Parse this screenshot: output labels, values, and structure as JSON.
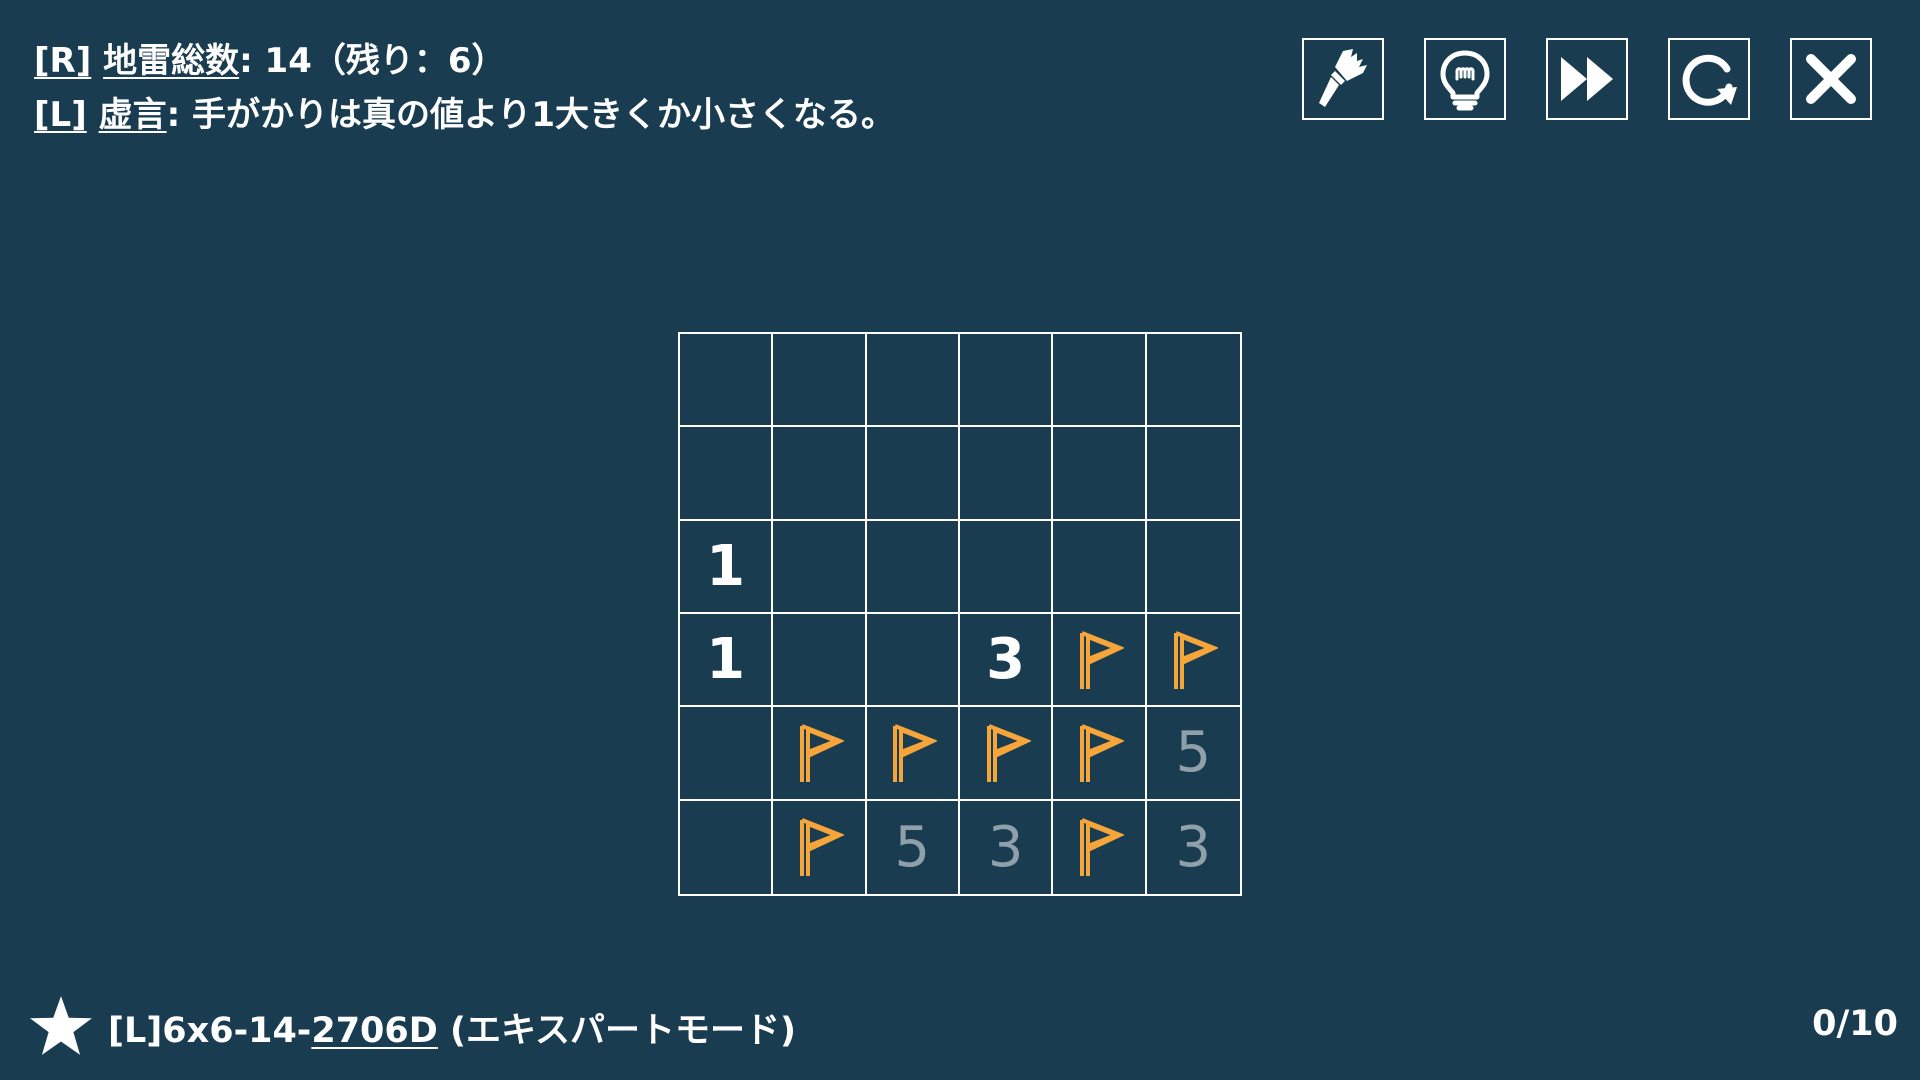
{
  "rules": {
    "line1": {
      "tag": "[R]",
      "name": "地雷総数",
      "text": ":  14（残り：6）"
    },
    "line2": {
      "tag": "[L]",
      "name": "虚言",
      "text": ": 手がかりは真の値より1大きくか小さくなる。"
    }
  },
  "toolbar": {
    "buttons": [
      {
        "name": "brush",
        "icon": "brush-icon"
      },
      {
        "name": "hint",
        "icon": "lightbulb-icon"
      },
      {
        "name": "skip",
        "icon": "fast-forward-icon"
      },
      {
        "name": "restart",
        "icon": "restart-icon"
      },
      {
        "name": "close",
        "icon": "close-icon"
      }
    ]
  },
  "board": {
    "rows": 6,
    "cols": 6,
    "cells": [
      [
        "",
        "",
        "",
        "",
        "",
        ""
      ],
      [
        "",
        "",
        "",
        "",
        "",
        ""
      ],
      [
        "1",
        "",
        "",
        "",
        "",
        ""
      ],
      [
        "1",
        "",
        "",
        "3",
        "F",
        "F"
      ],
      [
        "",
        "F",
        "F",
        "F",
        "F",
        "5r"
      ],
      [
        "",
        "F",
        "5r",
        "3r",
        "F",
        "3r"
      ]
    ],
    "colors": {
      "flag": "#f5a53a",
      "given_number": "#ffffff",
      "revealed_number": "#8fa0ab",
      "grid_line": "#ffffff"
    }
  },
  "footer": {
    "star_icon": "star-icon",
    "puzzle_prefix": "[L]6x6-14-",
    "puzzle_code": "2706D",
    "puzzle_mode": " (エキスパートモード)",
    "progress": "0/10"
  },
  "theme": {
    "background": "#1a3c51",
    "text": "#ffffff"
  }
}
